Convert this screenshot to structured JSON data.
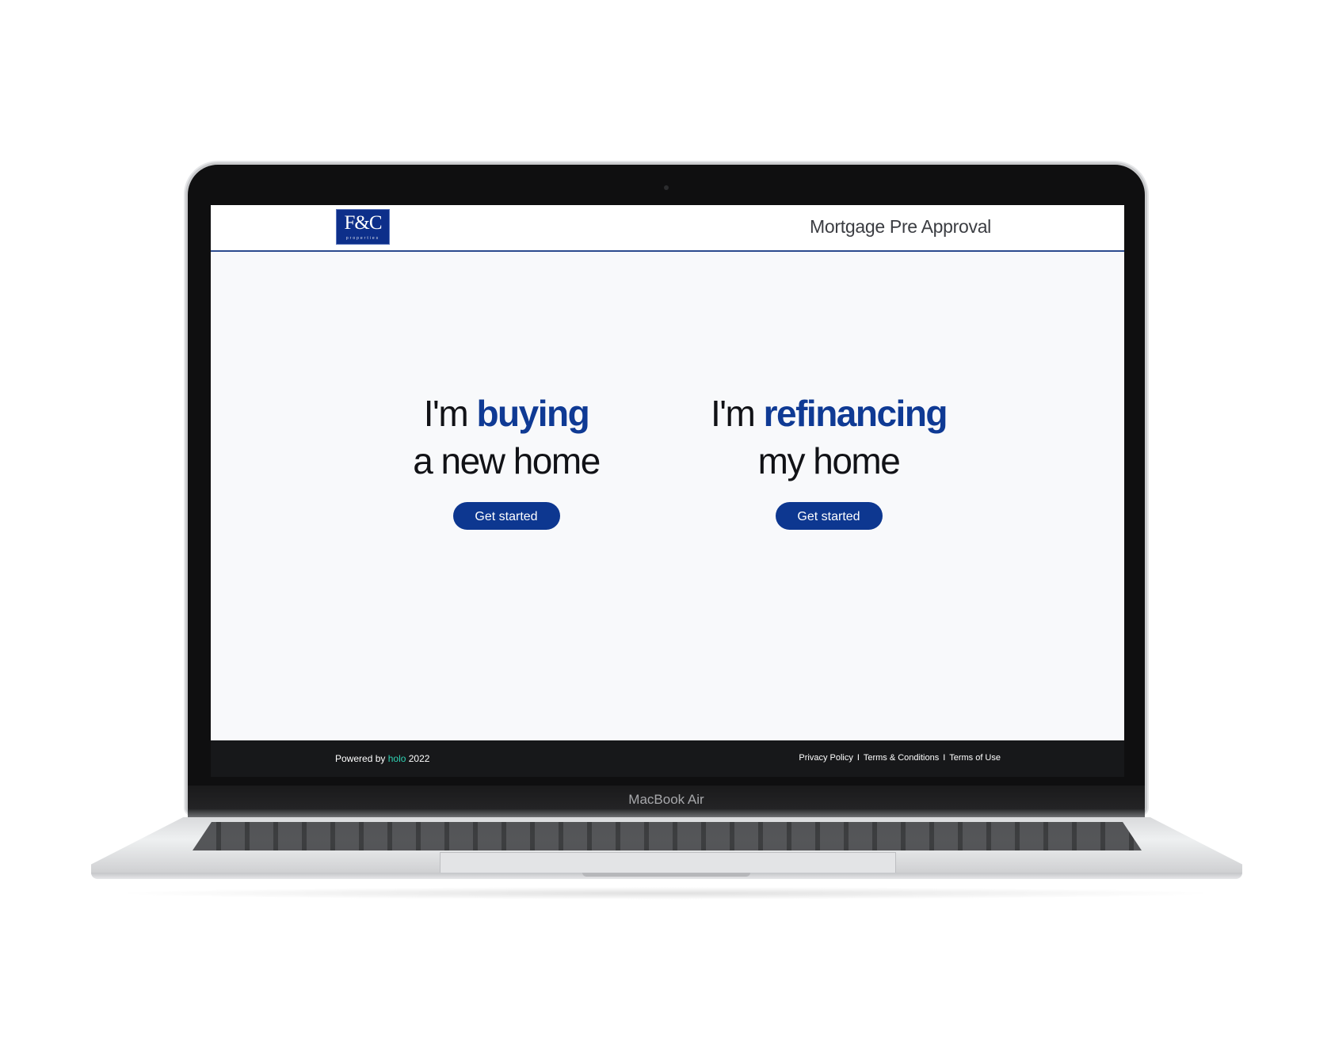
{
  "device": {
    "model_label": "MacBook Air"
  },
  "header": {
    "logo_mark": "F&C",
    "logo_sub": "properties",
    "title": "Mortgage Pre Approval"
  },
  "options": [
    {
      "lead": "I'm",
      "accent": "buying",
      "line2": "a new home",
      "cta_label": "Get started"
    },
    {
      "lead": "I'm",
      "accent": "refinancing",
      "line2": "my home",
      "cta_label": "Get started"
    }
  ],
  "footer": {
    "powered_prefix": "Powered by",
    "powered_brand": "holo",
    "powered_year": "2022",
    "links": {
      "privacy": "Privacy Policy",
      "terms_conditions": "Terms & Conditions",
      "terms_use": "Terms of Use",
      "separator": "I"
    }
  },
  "colors": {
    "accent_blue": "#0f3a94",
    "button_blue": "#0d3790",
    "footer_bg": "#17181a",
    "holo_teal": "#2fd1b2",
    "logo_bg": "#0d2f8a"
  }
}
